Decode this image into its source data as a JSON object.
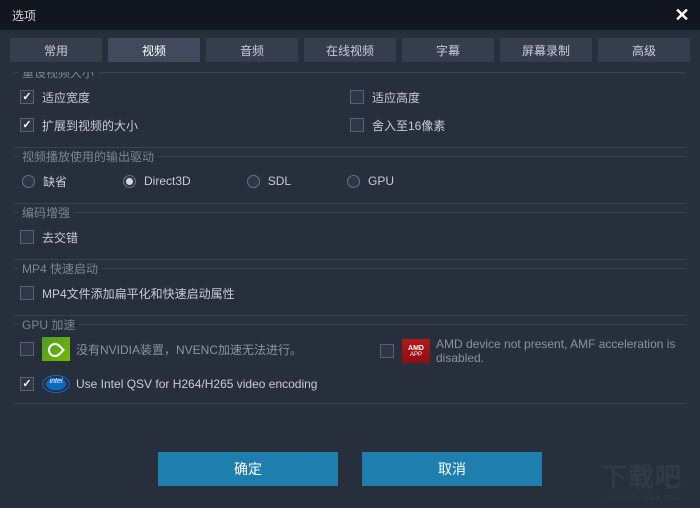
{
  "title": "选项",
  "tabs": [
    "常用",
    "视频",
    "音频",
    "在线视频",
    "字幕",
    "屏幕录制",
    "高级"
  ],
  "activeTab": 1,
  "sections": {
    "resize": {
      "title": "重设视频大小",
      "fitWidth": {
        "label": "适应宽度",
        "checked": true
      },
      "fitHeight": {
        "label": "适应高度",
        "checked": false
      },
      "expandToVideo": {
        "label": "扩展到视频的大小",
        "checked": true
      },
      "snap16": {
        "label": "舍入至16像素",
        "checked": false
      }
    },
    "output": {
      "title": "视频播放使用的输出驱动",
      "options": [
        "缺省",
        "Direct3D",
        "SDL",
        "GPU"
      ],
      "selected": 1
    },
    "enhance": {
      "title": "编码增强",
      "deinterlace": {
        "label": "去交错",
        "checked": false
      }
    },
    "mp4": {
      "title": "MP4 快速启动",
      "flatten": {
        "label": "MP4文件添加扁平化和快速启动属性",
        "checked": false
      }
    },
    "gpu": {
      "title": "GPU 加速",
      "nvidia": {
        "label": "没有NVIDIA装置，NVENC加速无法进行。",
        "checked": false
      },
      "amd": {
        "label": "AMD device not present, AMF acceleration is disabled.",
        "checked": false
      },
      "intel": {
        "label": "Use Intel QSV for H264/H265 video encoding",
        "checked": true
      }
    }
  },
  "buttons": {
    "ok": "确定",
    "cancel": "取消"
  },
  "watermark": {
    "main": "下载吧",
    "sub": "www.xiazaiba.com"
  }
}
